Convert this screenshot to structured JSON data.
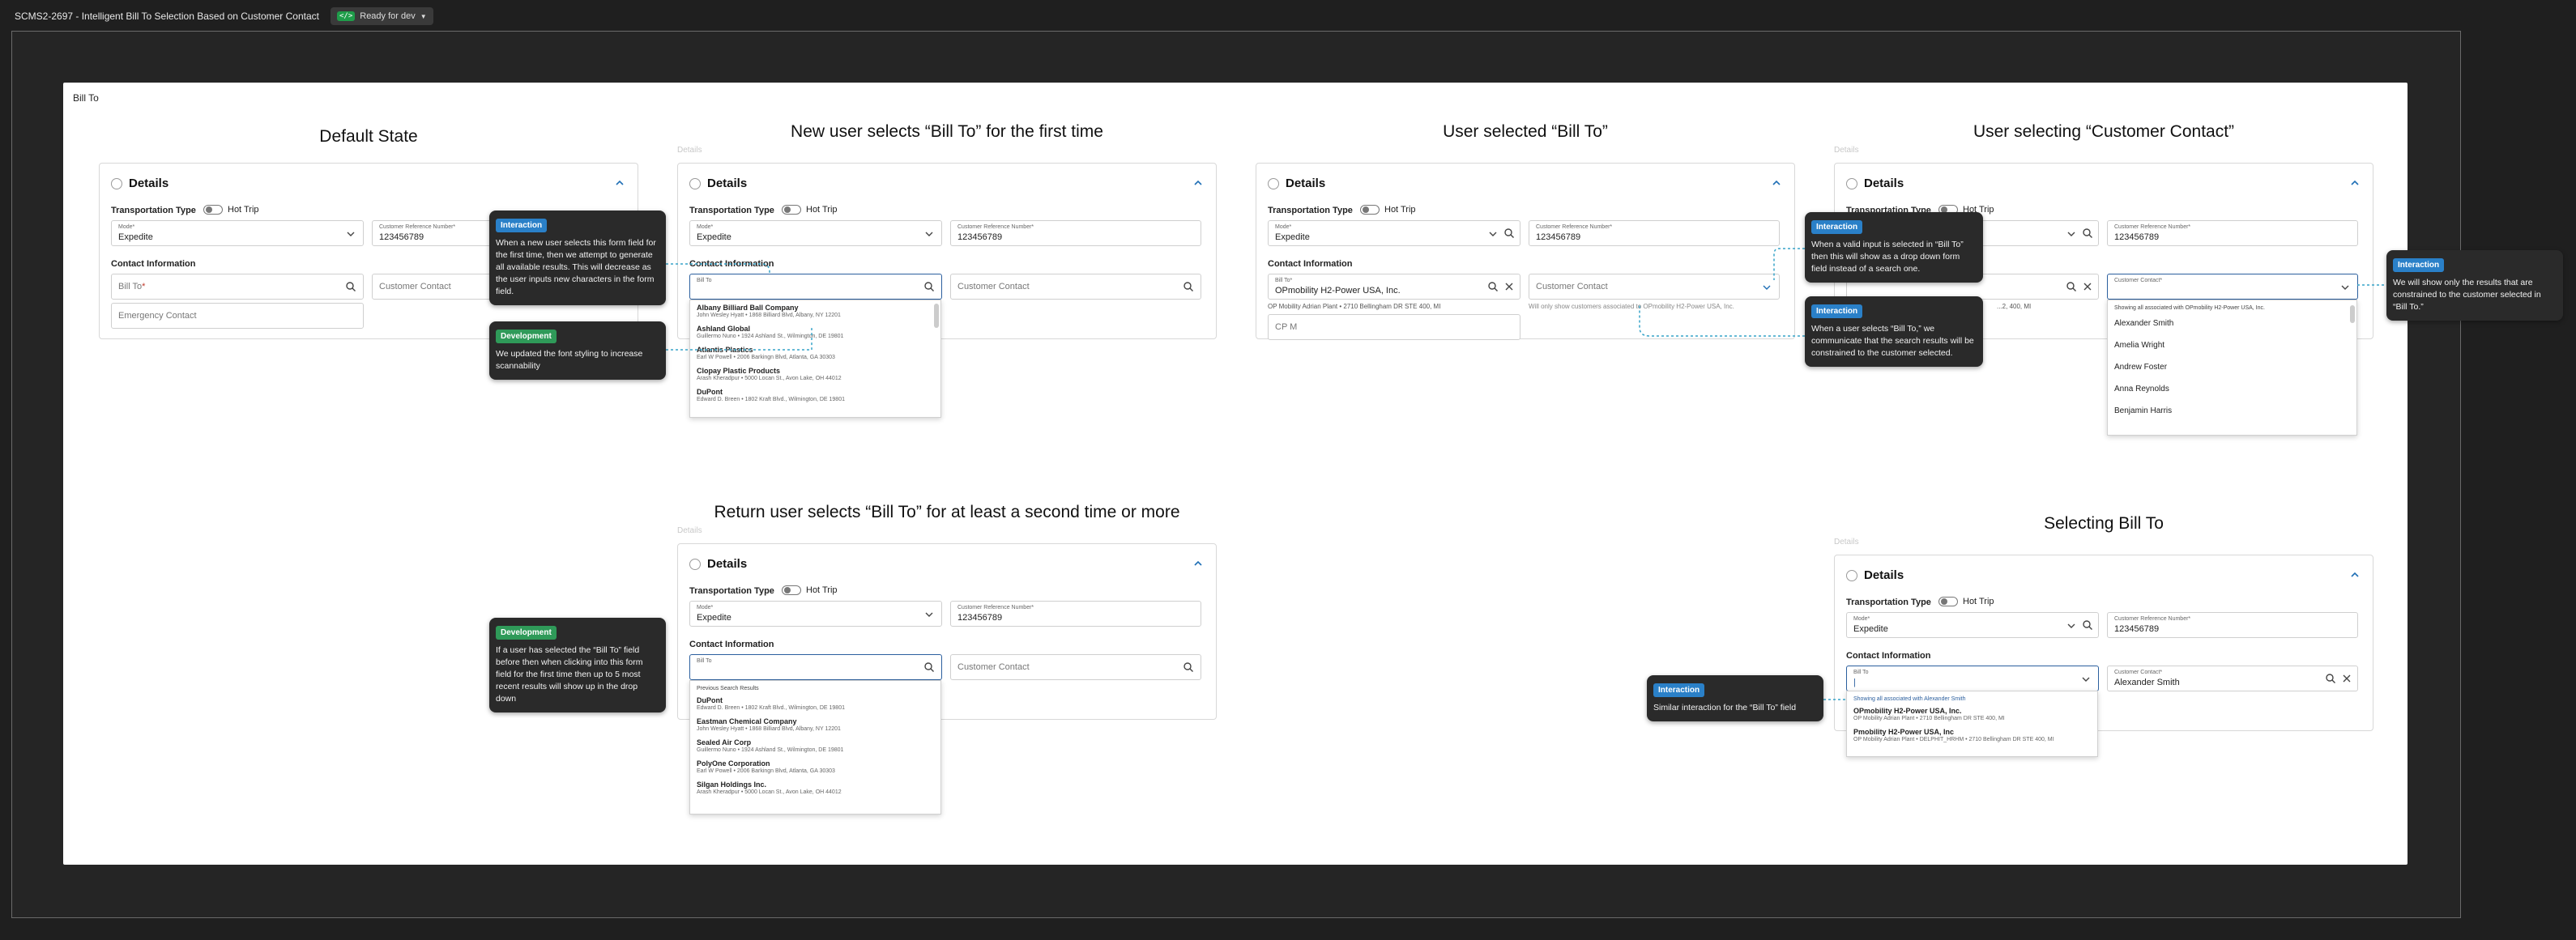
{
  "topbar": {
    "title": "SCMS2-2697 - Intelligent Bill To Selection Based on Customer Contact",
    "status": "Ready for dev"
  },
  "frame_label": "Bill To",
  "labels": {
    "details": "Details",
    "transportation_type": "Transportation Type",
    "hot_trip": "Hot Trip",
    "mode_label": "Mode*",
    "mode_value": "Expedite",
    "crn_label": "Customer Reference Number*",
    "crn_value": "123456789",
    "contact_info": "Contact Information",
    "bill_to_ph": "Bill To",
    "bill_to_small": "Bill To*",
    "customer_contact": "Customer Contact",
    "customer_contact_small": "Customer Contact*",
    "emergency_contact": "Emergency Contact",
    "ghost": "Details"
  },
  "sections": {
    "default": {
      "title": "Default State"
    },
    "first_time": {
      "title": "New user selects “Bill To” for the first time",
      "results": [
        {
          "name": "Albany Billiard Ball Company",
          "sub": "John Wesley Hyatt • 1868 Billiard Blvd, Albany, NY 12201"
        },
        {
          "name": "Ashland Global",
          "sub": "Guillermo Nuno • 1924 Ashland St., Wilmington, DE 19801"
        },
        {
          "name": "Atlantis Plastics",
          "sub": "Earl W Powell • 2006 Barkingn Blvd, Atlanta, GA 30303"
        },
        {
          "name": "Clopay Plastic Products",
          "sub": "Arash Kheradpur • 5000 Locan St., Avon Lake, OH 44012"
        },
        {
          "name": "DuPont",
          "sub": "Edward D. Breen • 1802 Kraft Blvd., Wilmington, DE 19801"
        }
      ]
    },
    "selected": {
      "title": "User selected “Bill To”",
      "bill_to_value": "OPmobility H2-Power USA, Inc.",
      "bill_to_addr": "OP Mobility Adrian Plant • 2710 Bellingham DR STE 400, MI",
      "note": "Will only show customers associated to OPmobility H2-Power USA, Inc.",
      "contact_field": "CP M"
    },
    "cc": {
      "title": "User selecting “Customer Contact”",
      "caption": "Showing all associated with OPmobility H2-Power USA, Inc.",
      "contacts": [
        "Alexander Smith",
        "Amelia Wright",
        "Andrew Foster",
        "Anna Reynolds",
        "Benjamin Harris"
      ],
      "partial_addr": "...2, 400, MI"
    },
    "return": {
      "title": "Return user selects “Bill To” for at least a second time or more",
      "caption": "Previous Search Results",
      "results": [
        {
          "name": "DuPont",
          "sub": "Edward D. Breen • 1802 Kraft Blvd., Wilmington, DE 19801"
        },
        {
          "name": "Eastman Chemical Company",
          "sub": "John Wesley Hyatt • 1868 Billiard Blvd, Albany, NY 12201"
        },
        {
          "name": "Sealed Air Corp",
          "sub": "Guillermo Nuno • 1924 Ashland St., Wilmington, DE 19801"
        },
        {
          "name": "PolyOne Corporation",
          "sub": "Earl W Powell • 2006 Barkingn Blvd, Atlanta, GA 30303"
        },
        {
          "name": "Silgan Holdings Inc.",
          "sub": "Arash Kheradpur • 5000 Locan St., Avon Lake, OH 44012"
        }
      ]
    },
    "selecting": {
      "title": "Selecting Bill To",
      "contact_value": "Alexander Smith",
      "caption": "Showing all associated with Alexander Smith",
      "results": [
        {
          "name": "OPmobility H2-Power USA, Inc.",
          "sub": "OP Mobility Adrian Plant • 2710 Bellingham DR STE 400, MI"
        },
        {
          "name": "Pmobility H2-Power USA, Inc",
          "sub": "OP Mobility Adrian Plant • DELPHIT_HRHM • 2710 Bellingham DR STE 400, MI"
        }
      ]
    }
  },
  "callouts": {
    "c1": {
      "badge": "Interaction",
      "text": "When a new user selects this form field for the first time, then we attempt to generate all available results. This will decrease as the user inputs new characters in the form field."
    },
    "c2": {
      "badge": "Development",
      "text": "We updated the font styling to increase scannability"
    },
    "c3": {
      "badge": "Interaction",
      "text": "When a valid input is selected in “Bill To” then this will show as a drop down form field instead of a search one."
    },
    "c4": {
      "badge": "Interaction",
      "text": "When a user selects “Bill To,” we communicate that the search results will be constrained to the customer selected."
    },
    "c5": {
      "badge": "Interaction",
      "text": "We will show only the results that are constrained to the customer selected in “Bill To.”"
    },
    "c6": {
      "badge": "Development",
      "text": "If a user has selected the “Bill To” field before then when clicking into this form field for the first time then up to 5 most recent results will show up in the drop down"
    },
    "c7": {
      "badge": "Interaction",
      "text": "Similar interaction for the “Bill To” field"
    }
  },
  "colors": {
    "accent": "#2a80c8",
    "dev": "#2f9a59",
    "connector": "#36a3c8",
    "active_border": "#2b5f9e"
  }
}
